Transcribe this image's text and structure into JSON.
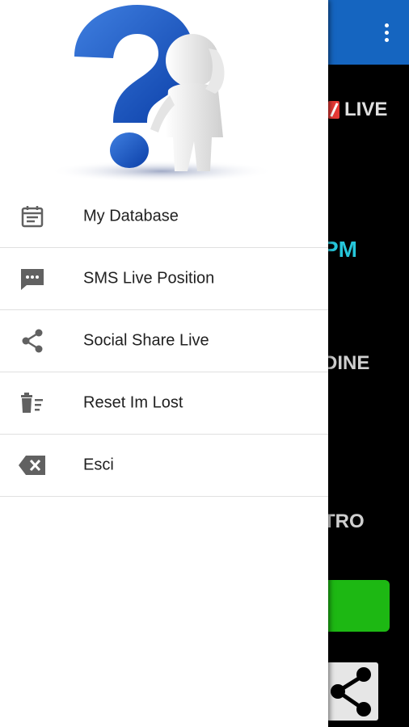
{
  "background": {
    "live_label": "LIVE",
    "text_pm": "PM",
    "text_dine": "DINE",
    "text_tro": "TRO",
    "toolbar_color": "#1565C0",
    "green_button_color": "#1DB813"
  },
  "drawer": {
    "header_image": "question-mark-thinking-figure",
    "items": [
      {
        "label": "My Database",
        "icon": "calendar-icon"
      },
      {
        "label": "SMS Live Position",
        "icon": "sms-icon"
      },
      {
        "label": "Social Share Live",
        "icon": "share-icon"
      },
      {
        "label": "Reset Im Lost",
        "icon": "delete-sweep-icon"
      },
      {
        "label": "Esci",
        "icon": "backspace-icon"
      }
    ]
  }
}
